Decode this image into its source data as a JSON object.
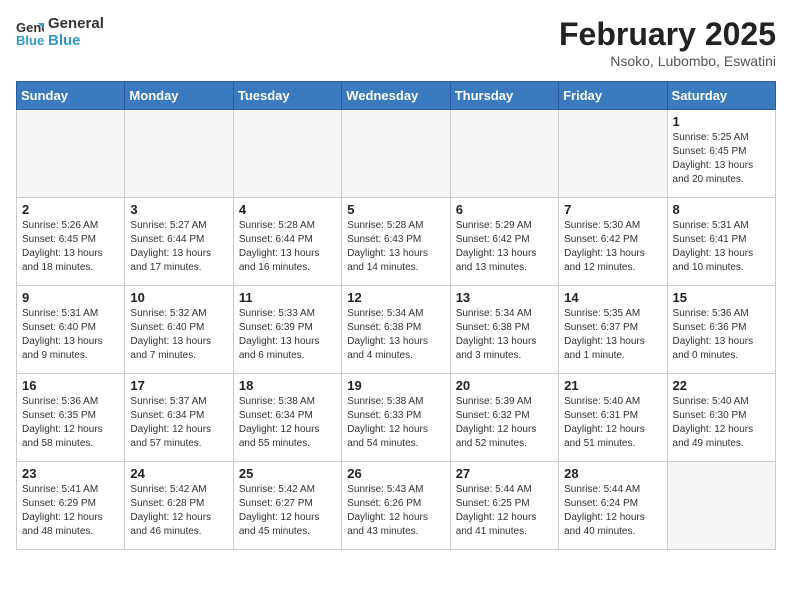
{
  "header": {
    "logo_general": "General",
    "logo_blue": "Blue",
    "title": "February 2025",
    "subtitle": "Nsoko, Lubombo, Eswatini"
  },
  "days_of_week": [
    "Sunday",
    "Monday",
    "Tuesday",
    "Wednesday",
    "Thursday",
    "Friday",
    "Saturday"
  ],
  "weeks": [
    [
      {
        "day": "",
        "info": ""
      },
      {
        "day": "",
        "info": ""
      },
      {
        "day": "",
        "info": ""
      },
      {
        "day": "",
        "info": ""
      },
      {
        "day": "",
        "info": ""
      },
      {
        "day": "",
        "info": ""
      },
      {
        "day": "1",
        "info": "Sunrise: 5:25 AM\nSunset: 6:45 PM\nDaylight: 13 hours\nand 20 minutes."
      }
    ],
    [
      {
        "day": "2",
        "info": "Sunrise: 5:26 AM\nSunset: 6:45 PM\nDaylight: 13 hours\nand 18 minutes."
      },
      {
        "day": "3",
        "info": "Sunrise: 5:27 AM\nSunset: 6:44 PM\nDaylight: 13 hours\nand 17 minutes."
      },
      {
        "day": "4",
        "info": "Sunrise: 5:28 AM\nSunset: 6:44 PM\nDaylight: 13 hours\nand 16 minutes."
      },
      {
        "day": "5",
        "info": "Sunrise: 5:28 AM\nSunset: 6:43 PM\nDaylight: 13 hours\nand 14 minutes."
      },
      {
        "day": "6",
        "info": "Sunrise: 5:29 AM\nSunset: 6:42 PM\nDaylight: 13 hours\nand 13 minutes."
      },
      {
        "day": "7",
        "info": "Sunrise: 5:30 AM\nSunset: 6:42 PM\nDaylight: 13 hours\nand 12 minutes."
      },
      {
        "day": "8",
        "info": "Sunrise: 5:31 AM\nSunset: 6:41 PM\nDaylight: 13 hours\nand 10 minutes."
      }
    ],
    [
      {
        "day": "9",
        "info": "Sunrise: 5:31 AM\nSunset: 6:40 PM\nDaylight: 13 hours\nand 9 minutes."
      },
      {
        "day": "10",
        "info": "Sunrise: 5:32 AM\nSunset: 6:40 PM\nDaylight: 13 hours\nand 7 minutes."
      },
      {
        "day": "11",
        "info": "Sunrise: 5:33 AM\nSunset: 6:39 PM\nDaylight: 13 hours\nand 6 minutes."
      },
      {
        "day": "12",
        "info": "Sunrise: 5:34 AM\nSunset: 6:38 PM\nDaylight: 13 hours\nand 4 minutes."
      },
      {
        "day": "13",
        "info": "Sunrise: 5:34 AM\nSunset: 6:38 PM\nDaylight: 13 hours\nand 3 minutes."
      },
      {
        "day": "14",
        "info": "Sunrise: 5:35 AM\nSunset: 6:37 PM\nDaylight: 13 hours\nand 1 minute."
      },
      {
        "day": "15",
        "info": "Sunrise: 5:36 AM\nSunset: 6:36 PM\nDaylight: 13 hours\nand 0 minutes."
      }
    ],
    [
      {
        "day": "16",
        "info": "Sunrise: 5:36 AM\nSunset: 6:35 PM\nDaylight: 12 hours\nand 58 minutes."
      },
      {
        "day": "17",
        "info": "Sunrise: 5:37 AM\nSunset: 6:34 PM\nDaylight: 12 hours\nand 57 minutes."
      },
      {
        "day": "18",
        "info": "Sunrise: 5:38 AM\nSunset: 6:34 PM\nDaylight: 12 hours\nand 55 minutes."
      },
      {
        "day": "19",
        "info": "Sunrise: 5:38 AM\nSunset: 6:33 PM\nDaylight: 12 hours\nand 54 minutes."
      },
      {
        "day": "20",
        "info": "Sunrise: 5:39 AM\nSunset: 6:32 PM\nDaylight: 12 hours\nand 52 minutes."
      },
      {
        "day": "21",
        "info": "Sunrise: 5:40 AM\nSunset: 6:31 PM\nDaylight: 12 hours\nand 51 minutes."
      },
      {
        "day": "22",
        "info": "Sunrise: 5:40 AM\nSunset: 6:30 PM\nDaylight: 12 hours\nand 49 minutes."
      }
    ],
    [
      {
        "day": "23",
        "info": "Sunrise: 5:41 AM\nSunset: 6:29 PM\nDaylight: 12 hours\nand 48 minutes."
      },
      {
        "day": "24",
        "info": "Sunrise: 5:42 AM\nSunset: 6:28 PM\nDaylight: 12 hours\nand 46 minutes."
      },
      {
        "day": "25",
        "info": "Sunrise: 5:42 AM\nSunset: 6:27 PM\nDaylight: 12 hours\nand 45 minutes."
      },
      {
        "day": "26",
        "info": "Sunrise: 5:43 AM\nSunset: 6:26 PM\nDaylight: 12 hours\nand 43 minutes."
      },
      {
        "day": "27",
        "info": "Sunrise: 5:44 AM\nSunset: 6:25 PM\nDaylight: 12 hours\nand 41 minutes."
      },
      {
        "day": "28",
        "info": "Sunrise: 5:44 AM\nSunset: 6:24 PM\nDaylight: 12 hours\nand 40 minutes."
      },
      {
        "day": "",
        "info": ""
      }
    ]
  ]
}
